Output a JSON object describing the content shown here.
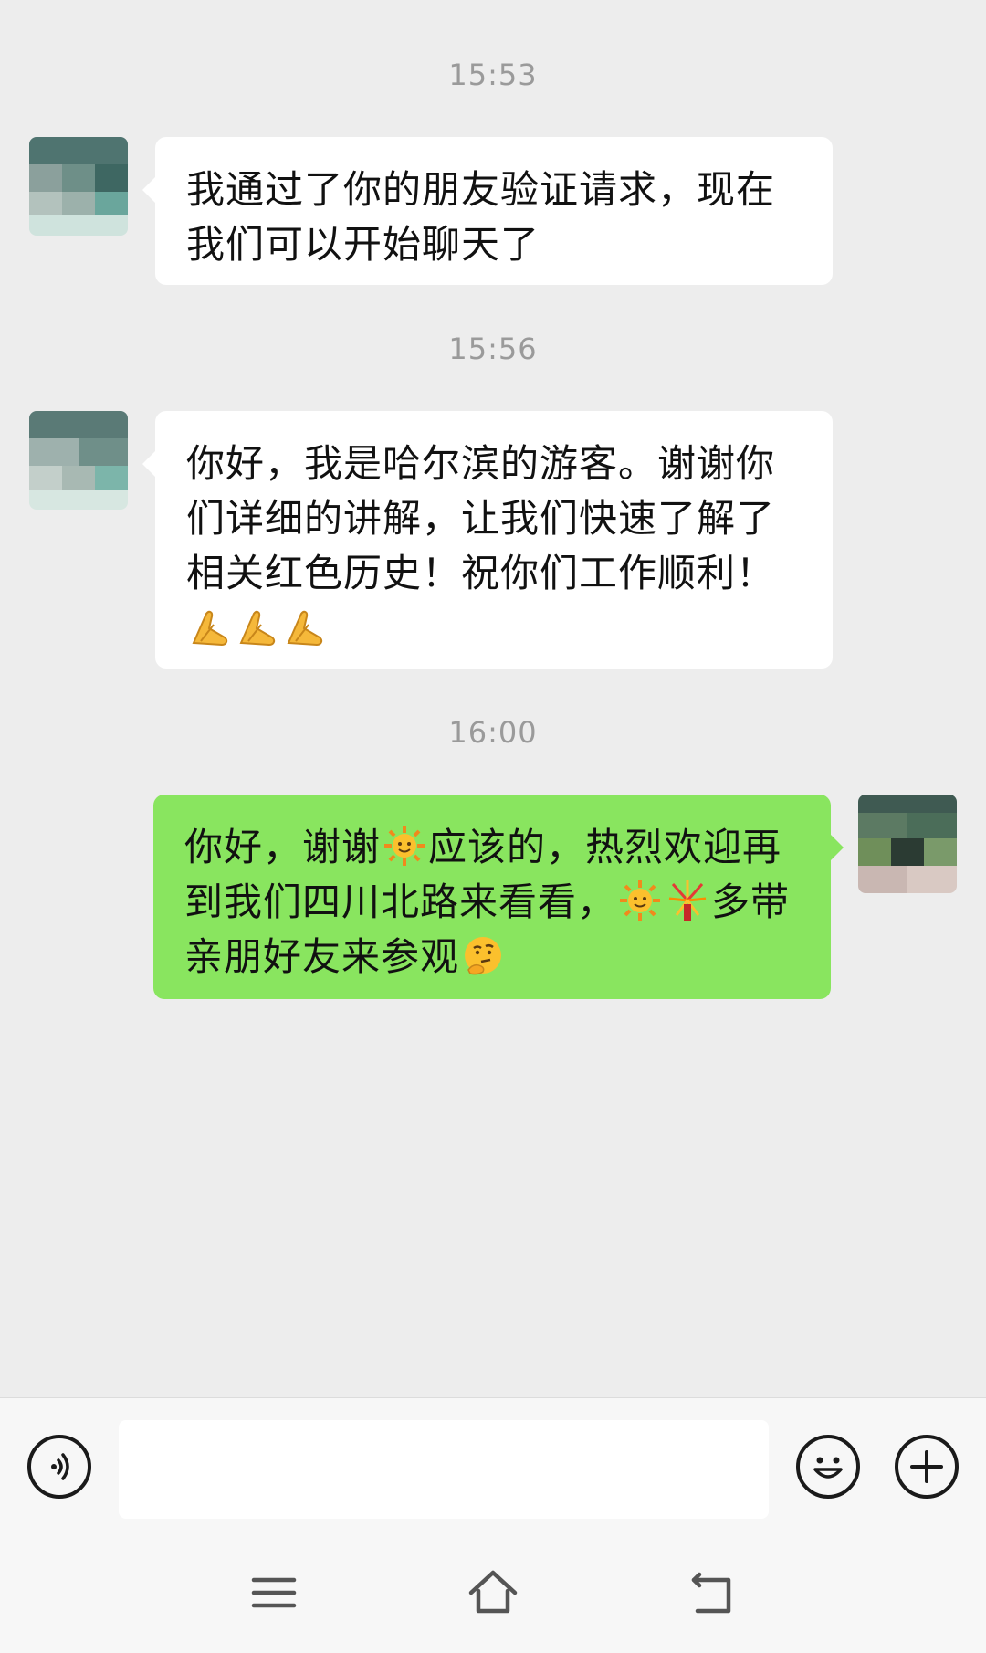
{
  "chat": {
    "messages": [
      {
        "timestamp": "15:53",
        "direction": "incoming",
        "text": "我通过了你的朋友验证请求，现在我们可以开始聊天了"
      },
      {
        "timestamp": "15:56",
        "direction": "incoming",
        "text_parts": [
          "你好，我是哈尔滨的游客。谢谢你们详细的讲解，让我们快速了解了相关红色历史！祝你们工作顺利！"
        ],
        "emojis": [
          "folded-hands-emoji",
          "folded-hands-emoji",
          "folded-hands-emoji"
        ]
      },
      {
        "timestamp": "16:00",
        "direction": "outgoing",
        "text_parts": [
          "你好，谢谢",
          "应该的，热烈欢迎再到我们四川北路来看看，",
          "多带亲朋好友来参观"
        ],
        "emojis": [
          "sun-emoji",
          "sun-emoji",
          "fireworks-emoji",
          "thinking-face-emoji"
        ]
      }
    ]
  },
  "input_bar": {
    "placeholder": "",
    "icons": [
      "voice-icon",
      "emoji-smile-icon",
      "plus-icon"
    ]
  },
  "nav": {
    "icons": [
      "menu-icon",
      "home-icon",
      "back-icon"
    ]
  },
  "colors": {
    "background": "#ededed",
    "incoming_bubble": "#ffffff",
    "outgoing_bubble": "#89e55f",
    "timestamp_text": "#9a9a9a"
  }
}
